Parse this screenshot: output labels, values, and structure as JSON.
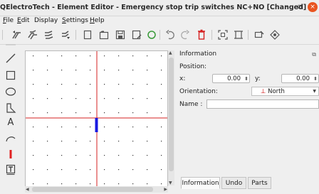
{
  "window": {
    "title": "QElectroTech - Element Editor - Emergency stop trip switches NC+NO [Changed]",
    "minimize": "–",
    "maximize": "▫",
    "close": "×"
  },
  "menu": {
    "items": [
      {
        "key": "F",
        "rest": "ile"
      },
      {
        "key": "E",
        "rest": "dit"
      },
      {
        "key": "",
        "rest": "Display"
      },
      {
        "key": "S",
        "rest": "ettings"
      },
      {
        "key": "H",
        "rest": "elp"
      }
    ]
  },
  "toolbar": {
    "icons": [
      "raise-icon",
      "bring-front-icon",
      "lower-icon",
      "send-back-icon",
      "new-icon",
      "open-icon",
      "save-icon",
      "save-as-icon",
      "reload-icon",
      "undo-icon",
      "redo-icon",
      "delete-icon",
      "zoom-fit-icon",
      "zoom-reset-icon",
      "edit-names-icon",
      "edit-info-icon"
    ]
  },
  "tools": [
    "line-icon",
    "rectangle-icon",
    "ellipse-icon",
    "polygon-icon",
    "text-icon",
    "arc-icon",
    "terminal-icon",
    "dynamic-text-icon"
  ],
  "tools_text": "A",
  "panel": {
    "title": "Information",
    "position_label": "Position:",
    "x_label": "x:",
    "x_value": "0.00",
    "y_label": "y:",
    "y_value": "0.00",
    "orientation_label": "Orientation:",
    "orientation_symbol": "⊥",
    "orientation_value": "North",
    "name_label": "Name :",
    "name_value": ""
  },
  "tabs": [
    {
      "label": "Information",
      "active": true
    },
    {
      "label": "Undo",
      "active": false
    },
    {
      "label": "Parts",
      "active": false
    }
  ],
  "colors": {
    "accent": "#e95420",
    "axis": "#d62020",
    "terminal": "#1a1ae0",
    "grid_dot": "#333333"
  }
}
